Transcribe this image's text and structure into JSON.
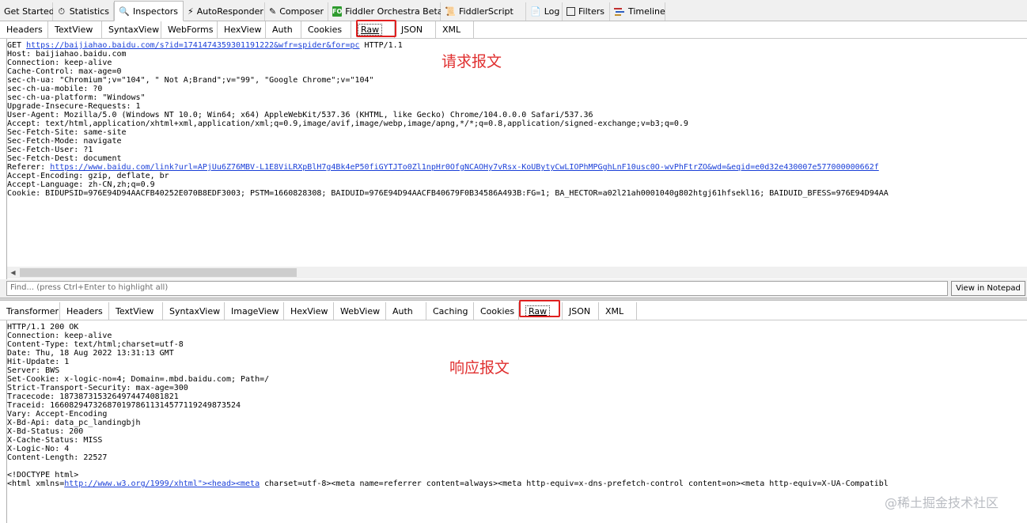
{
  "top_tabs": [
    {
      "label": "Get Started",
      "icon": "none"
    },
    {
      "label": "Statistics",
      "icon": "timer-icon"
    },
    {
      "label": "Inspectors",
      "icon": "magnifier-icon"
    },
    {
      "label": "AutoResponder",
      "icon": "lightning-icon"
    },
    {
      "label": "Composer",
      "icon": "pencil-icon"
    },
    {
      "label": "Fiddler Orchestra Beta",
      "icon": "fo-icon",
      "icon_text": "FO"
    },
    {
      "label": "FiddlerScript",
      "icon": "script-icon"
    },
    {
      "label": "Log",
      "icon": "log-icon"
    },
    {
      "label": "Filters",
      "icon": "checkbox-icon"
    },
    {
      "label": "Timeline",
      "icon": "timeline-icon"
    }
  ],
  "request_tabs": [
    "Headers",
    "TextView",
    "SyntaxView",
    "WebForms",
    "HexView",
    "Auth",
    "Cookies",
    "Raw",
    "JSON",
    "XML"
  ],
  "request": {
    "line1_method": "GET ",
    "line1_url": "https://baijiahao.baidu.com/s?id=1741474359301191222&wfr=spider&for=pc",
    "line1_proto": " HTTP/1.1",
    "headers_a": "Host: baijiahao.baidu.com\nConnection: keep-alive\nCache-Control: max-age=0\nsec-ch-ua: \"Chromium\";v=\"104\", \" Not A;Brand\";v=\"99\", \"Google Chrome\";v=\"104\"\nsec-ch-ua-mobile: ?0\nsec-ch-ua-platform: \"Windows\"\nUpgrade-Insecure-Requests: 1\nUser-Agent: Mozilla/5.0 (Windows NT 10.0; Win64; x64) AppleWebKit/537.36 (KHTML, like Gecko) Chrome/104.0.0.0 Safari/537.36\nAccept: text/html,application/xhtml+xml,application/xml;q=0.9,image/avif,image/webp,image/apng,*/*;q=0.8,application/signed-exchange;v=b3;q=0.9\nSec-Fetch-Site: same-site\nSec-Fetch-Mode: navigate\nSec-Fetch-User: ?1\nSec-Fetch-Dest: document",
    "referer_label": "Referer: ",
    "referer_url": "https://www.baidu.com/link?url=APjUu6Z76MBV-L1E8ViLRXpBlH7g4Bk4eP50fiGYTJTo0Zl1npHr0OfgNCAOHy7vRsx-KoUBytyCwLIOPhMPGghLnF10usc0O-wvPhFtrZO&wd=&eqid=e0d32e430007e577000000662f",
    "headers_b": "Accept-Encoding: gzip, deflate, br\nAccept-Language: zh-CN,zh;q=0.9\nCookie: BIDUPSID=976E94D94AACFB40252E070B8EDF3003; PSTM=1660828308; BAIDUID=976E94D94AACFB40679F0B34586A493B:FG=1; BA_HECTOR=a02l21ah0001040g802htgj61hfsekl16; BAIDUID_BFESS=976E94D94AA"
  },
  "request_note": "请求报文",
  "find": {
    "placeholder": "Find... (press Ctrl+Enter to highlight all)",
    "notepad_button": "View in Notepad"
  },
  "response_tabs": [
    "Transformer",
    "Headers",
    "TextView",
    "SyntaxView",
    "ImageView",
    "HexView",
    "WebView",
    "Auth",
    "Caching",
    "Cookies",
    "Raw",
    "JSON",
    "XML"
  ],
  "response": {
    "headers": "HTTP/1.1 200 OK\nConnection: keep-alive\nContent-Type: text/html;charset=utf-8\nDate: Thu, 18 Aug 2022 13:31:13 GMT\nHit-Update: 1\nServer: BWS\nSet-Cookie: x-logic-no=4; Domain=.mbd.baidu.com; Path=/\nStrict-Transport-Security: max-age=300\nTracecode: 18738731532649744740818​21\nTraceid: 1660829473268701978611314577119249873524\nVary: Accept-Encoding\nX-Bd-Api: data_pc_landingbjh\nX-Bd-Status: 200\nX-Cache-Status: MISS\nX-Logic-No: 4\nContent-Length: 22527",
    "doctype": "<!DOCTYPE html>",
    "html_prefix": "<html xmlns=",
    "html_link": "http://www.w3.org/1999/xhtml\"><head><meta",
    "html_suffix": " charset=utf-8><meta name=referrer content=always><meta http-equiv=x-dns-prefetch-control content=on><meta http-equiv=X-UA-Compatibl"
  },
  "response_note": "响应报文",
  "watermark": "@稀土掘金技术社区",
  "accent_color": "#e02020",
  "link_color": "#1a3fd8"
}
